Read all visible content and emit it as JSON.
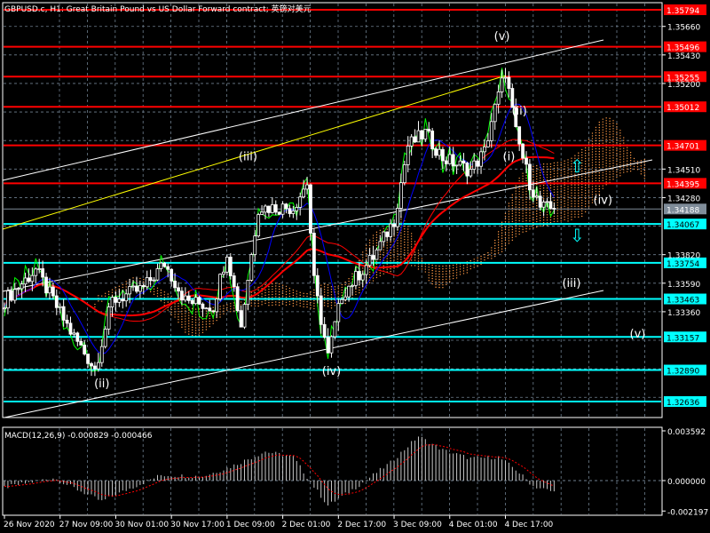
{
  "header": {
    "title": "GBPUSD.c, H1:  Great Britain Pound vs US Dollar Forward contract; 英镑对美元"
  },
  "colors": {
    "background": "#000000",
    "resistance": "#ff0000",
    "support": "#00ffff",
    "current": "#7f8c99",
    "grid": "#6f7f8f",
    "candle": "#ffffff",
    "ma_red": "#ff0000",
    "green": "#00ff00",
    "blue": "#0000ff",
    "cloud": "#ff9944",
    "yellow": "#ffff00"
  },
  "chart_data": [
    {
      "type": "candlestick",
      "title": "GBPUSD.c, H1",
      "ylim": [
        1.3256,
        1.3583
      ],
      "y_ticks": [
        "1.35660",
        "1.35430",
        "1.35200",
        "1.34510",
        "1.34280",
        "1.33820",
        "1.33590",
        "1.33360"
      ],
      "x_ticks": [
        {
          "bar": 0,
          "label": "26 Nov 2020"
        },
        {
          "bar": 16,
          "label": "27 Nov 09:00"
        },
        {
          "bar": 32,
          "label": "30 Nov 01:00"
        },
        {
          "bar": 48,
          "label": "30 Nov 17:00"
        },
        {
          "bar": 64,
          "label": "1 Dec 09:00"
        },
        {
          "bar": 80,
          "label": "2 Dec 01:00"
        },
        {
          "bar": 96,
          "label": "2 Dec 17:00"
        },
        {
          "bar": 112,
          "label": "3 Dec 09:00"
        },
        {
          "bar": 128,
          "label": "4 Dec 01:00"
        },
        {
          "bar": 144,
          "label": "4 Dec 17:00"
        }
      ],
      "close_keypoints": [
        [
          0,
          1.3345
        ],
        [
          9,
          1.337
        ],
        [
          15,
          1.334
        ],
        [
          19,
          1.332
        ],
        [
          26,
          1.329
        ],
        [
          31,
          1.3345
        ],
        [
          40,
          1.3355
        ],
        [
          46,
          1.3375
        ],
        [
          52,
          1.3345
        ],
        [
          60,
          1.334
        ],
        [
          64,
          1.3385
        ],
        [
          68,
          1.3325
        ],
        [
          73,
          1.342
        ],
        [
          83,
          1.342
        ],
        [
          87,
          1.344
        ],
        [
          89,
          1.336
        ],
        [
          93,
          1.33
        ],
        [
          97,
          1.335
        ],
        [
          106,
          1.338
        ],
        [
          112,
          1.341
        ],
        [
          116,
          1.347
        ],
        [
          121,
          1.348
        ],
        [
          126,
          1.346
        ],
        [
          134,
          1.345
        ],
        [
          138,
          1.3465
        ],
        [
          140,
          1.349
        ],
        [
          144,
          1.353
        ],
        [
          147,
          1.348
        ],
        [
          151,
          1.344
        ],
        [
          154,
          1.342
        ],
        [
          158,
          1.34188
        ]
      ],
      "resistance_levels": [
        "1.35794",
        "1.35496",
        "1.35255",
        "1.35012",
        "1.34701",
        "1.34395"
      ],
      "support_levels": [
        "1.34067",
        "1.33754",
        "1.33463",
        "1.33157",
        "1.32890",
        "1.32636"
      ],
      "current_price": "1.34188",
      "wave_labels": [
        {
          "text": "(v)",
          "bar": 143,
          "price": 1.3555
        },
        {
          "text": "(ii)",
          "bar": 148,
          "price": 1.3495
        },
        {
          "text": "(i)",
          "bar": 145,
          "price": 1.3458
        },
        {
          "text": "(iii)",
          "bar": 70,
          "price": 1.3458
        },
        {
          "text": "(iv)",
          "bar": 172,
          "price": 1.3423
        },
        {
          "text": "(iii)",
          "bar": 163,
          "price": 1.3356
        },
        {
          "text": "(v)",
          "bar": 182,
          "price": 1.3315
        },
        {
          "text": "(ii)",
          "bar": 28,
          "price": 1.3275
        },
        {
          "text": "(iv)",
          "bar": 94,
          "price": 1.3285
        }
      ]
    },
    {
      "type": "bar",
      "title": "MACD(12,26,9) -0.000829 -0.000466",
      "ylim": [
        -0.002197,
        0.003592
      ],
      "y_ticks": [
        "0.003592",
        "0.000000",
        "-0.002197"
      ],
      "histogram_keypoints": [
        [
          0,
          -0.0005
        ],
        [
          14,
          0.0002
        ],
        [
          28,
          -0.0015
        ],
        [
          34,
          -0.0008
        ],
        [
          45,
          0.0004
        ],
        [
          57,
          0.0003
        ],
        [
          65,
          0.001
        ],
        [
          75,
          0.0021
        ],
        [
          83,
          0.0017
        ],
        [
          88,
          -0.0001
        ],
        [
          93,
          -0.0018
        ],
        [
          101,
          -0.0005
        ],
        [
          111,
          0.0013
        ],
        [
          119,
          0.0032
        ],
        [
          126,
          0.0022
        ],
        [
          134,
          0.0016
        ],
        [
          142,
          0.0017
        ],
        [
          147,
          0.0008
        ],
        [
          152,
          -0.0004
        ],
        [
          158,
          -0.000829
        ]
      ],
      "signal_last": -0.000466
    }
  ]
}
